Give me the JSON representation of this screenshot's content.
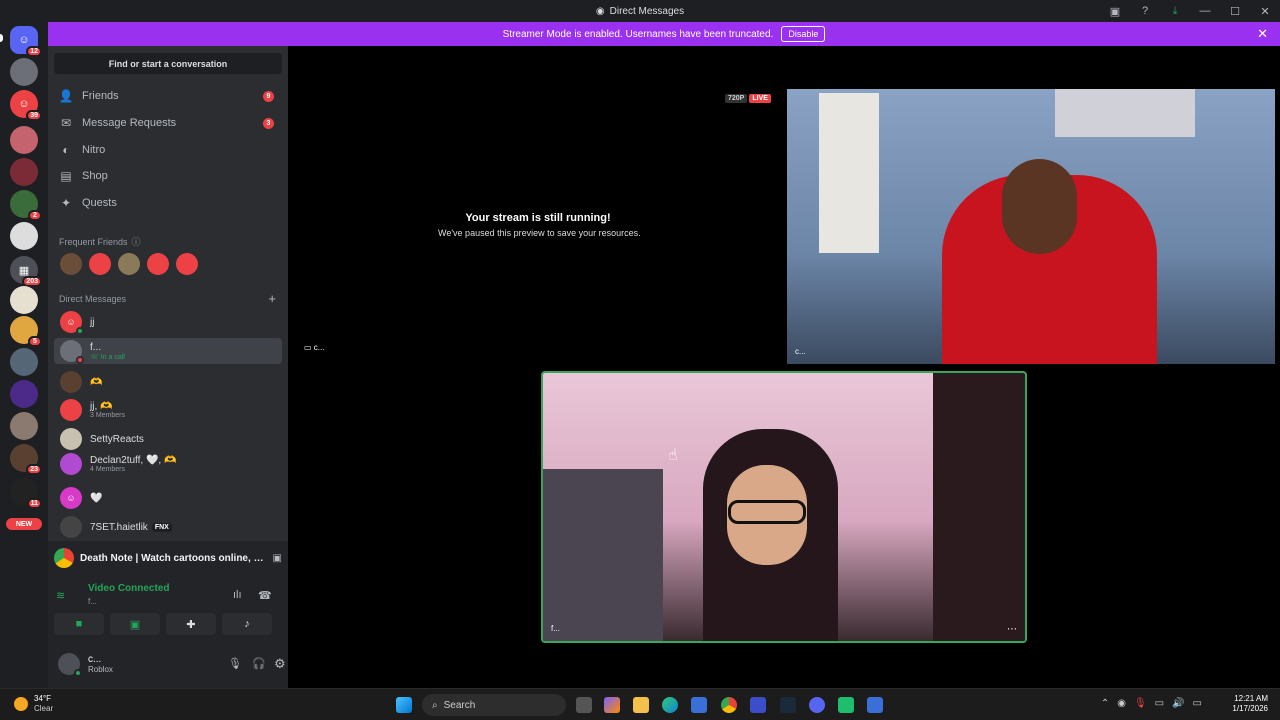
{
  "titlebar": {
    "title": "Direct Messages"
  },
  "banner": {
    "text": "Streamer Mode is enabled. Usernames have been truncated.",
    "disable_label": "Disable"
  },
  "servers": [
    {
      "badge": "12"
    },
    {
      "badge": ""
    },
    {
      "badge": "39"
    },
    {
      "badge": ""
    },
    {
      "badge": ""
    },
    {
      "badge": "2"
    },
    {
      "badge": ""
    },
    {
      "badge": "203"
    },
    {
      "badge": ""
    },
    {
      "badge": "5"
    },
    {
      "badge": ""
    },
    {
      "badge": ""
    },
    {
      "badge": ""
    },
    {
      "badge": "23"
    },
    {
      "badge": "11"
    }
  ],
  "new_label": "NEW",
  "sidebar": {
    "search_label": "Find or start a conversation",
    "nav": [
      {
        "label": "Friends",
        "count": "9"
      },
      {
        "label": "Message Requests",
        "count": "3"
      },
      {
        "label": "Nitro",
        "count": ""
      },
      {
        "label": "Shop",
        "count": ""
      },
      {
        "label": "Quests",
        "count": ""
      }
    ],
    "frequent_friends_label": "Frequent Friends",
    "direct_messages_label": "Direct Messages",
    "dms": [
      {
        "name": "jj",
        "sub": ""
      },
      {
        "name": "f...",
        "sub": "In a call"
      },
      {
        "name": "🫶",
        "sub": ""
      },
      {
        "name": "jj, 🫶",
        "sub": "3 Members"
      },
      {
        "name": "SettyReacts",
        "sub": ""
      },
      {
        "name": "Declan2tuff, 🤍, 🫶",
        "sub": "4 Members"
      },
      {
        "name": "🤍",
        "sub": ""
      },
      {
        "name": "7SET.haietlik",
        "sub": "",
        "tag": "FNX"
      }
    ]
  },
  "voice": {
    "activity": "Death Note | Watch cartoons online, Watch ...",
    "status": "Video Connected",
    "channel": "f..."
  },
  "user": {
    "name": "c...",
    "activity": "Roblox"
  },
  "stream": {
    "quality": "720P",
    "live": "LIVE",
    "heading": "Your stream is still running!",
    "sub": "We've paused this preview to save your resources.",
    "label": "c..."
  },
  "tiles": {
    "top_right_label": "c...",
    "bottom_label": "f..."
  },
  "taskbar": {
    "temp": "34°F",
    "weather": "Clear",
    "search": "Search",
    "time": "12:21 AM",
    "date": "1/17/2026"
  },
  "colors": {
    "accent": "#9b31f0",
    "online": "#23a55a",
    "danger": "#ed4245"
  }
}
